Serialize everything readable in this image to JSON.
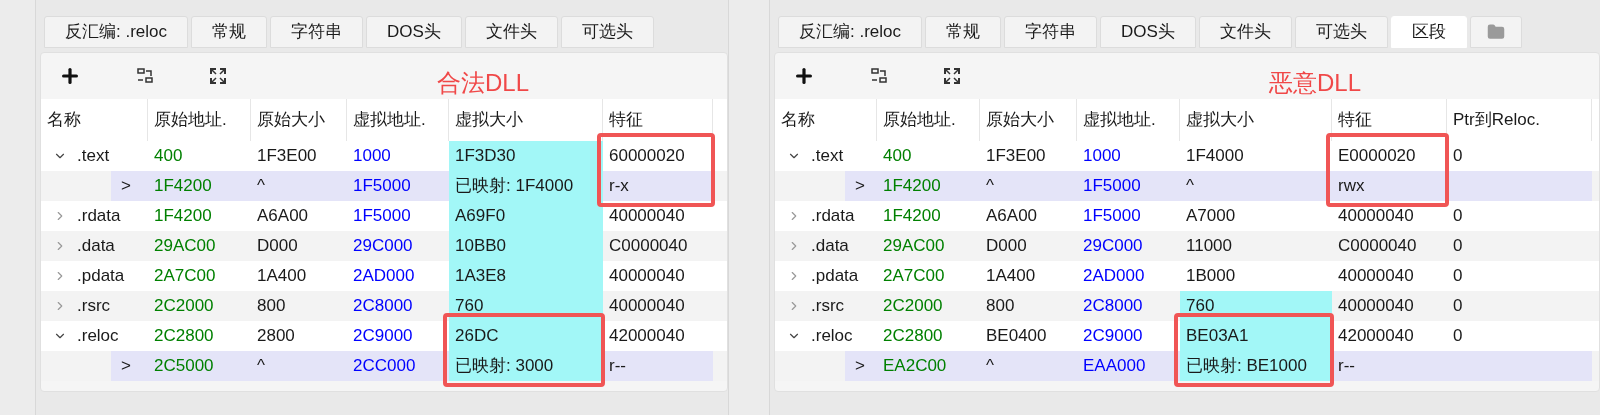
{
  "panels": [
    {
      "tabs": [
        {
          "label": "反汇编: .reloc",
          "selected": false,
          "kind": "text"
        },
        {
          "label": "常规",
          "selected": false,
          "kind": "text"
        },
        {
          "label": "字符串",
          "selected": false,
          "kind": "text"
        },
        {
          "label": "DOS头",
          "selected": false,
          "kind": "text"
        },
        {
          "label": "文件头",
          "selected": false,
          "kind": "text"
        },
        {
          "label": "可选头",
          "selected": false,
          "kind": "text"
        }
      ],
      "annotation": "合法DLL",
      "columns": [
        {
          "label": "名称",
          "kind": "name"
        },
        {
          "label": "原始地址.",
          "kind": "raw_addr"
        },
        {
          "label": "原始大小",
          "kind": "plain"
        },
        {
          "label": "虚拟地址.",
          "kind": "virt_addr"
        },
        {
          "label": "虚拟大小",
          "kind": "plain"
        },
        {
          "label": "特征",
          "kind": "plain"
        }
      ],
      "rows": [
        {
          "expanded": true,
          "cells": [
            {
              "text": ".text"
            },
            {
              "text": "400"
            },
            {
              "text": "1F3E00"
            },
            {
              "text": "1000"
            },
            {
              "text": "1F3D30",
              "highlighted": true
            },
            {
              "text": "60000020",
              "boxed": true
            }
          ],
          "children": [
            {
              "cells": [
                {
                  "text": ">"
                },
                {
                  "text": "1F4200"
                },
                {
                  "text": "^"
                },
                {
                  "text": "1F5000"
                },
                {
                  "text": "已映射: 1F4000",
                  "highlighted": true
                },
                {
                  "text": "r-x",
                  "boxed": true
                }
              ]
            }
          ]
        },
        {
          "expanded": false,
          "cells": [
            {
              "text": ".rdata"
            },
            {
              "text": "1F4200"
            },
            {
              "text": "A6A00"
            },
            {
              "text": "1F5000"
            },
            {
              "text": "A69F0",
              "highlighted": true
            },
            {
              "text": "40000040"
            }
          ]
        },
        {
          "expanded": false,
          "cells": [
            {
              "text": ".data"
            },
            {
              "text": "29AC00"
            },
            {
              "text": "D000"
            },
            {
              "text": "29C000"
            },
            {
              "text": "10BB0",
              "highlighted": true
            },
            {
              "text": "C0000040"
            }
          ]
        },
        {
          "expanded": false,
          "cells": [
            {
              "text": ".pdata"
            },
            {
              "text": "2A7C00"
            },
            {
              "text": "1A400"
            },
            {
              "text": "2AD000"
            },
            {
              "text": "1A3E8",
              "highlighted": true
            },
            {
              "text": "40000040"
            }
          ]
        },
        {
          "expanded": false,
          "cells": [
            {
              "text": ".rsrc"
            },
            {
              "text": "2C2000"
            },
            {
              "text": "800"
            },
            {
              "text": "2C8000"
            },
            {
              "text": "760",
              "highlighted": true
            },
            {
              "text": "40000040"
            }
          ]
        },
        {
          "expanded": true,
          "cells": [
            {
              "text": ".reloc"
            },
            {
              "text": "2C2800"
            },
            {
              "text": "2800"
            },
            {
              "text": "2C9000"
            },
            {
              "text": "26DC",
              "highlighted": true,
              "boxed": true
            },
            {
              "text": "42000040"
            }
          ],
          "children": [
            {
              "cells": [
                {
                  "text": ">"
                },
                {
                  "text": "2C5000"
                },
                {
                  "text": "^"
                },
                {
                  "text": "2CC000"
                },
                {
                  "text": "已映射: 3000",
                  "highlighted": true,
                  "boxed": true
                },
                {
                  "text": "r--"
                }
              ]
            }
          ]
        }
      ]
    },
    {
      "tabs": [
        {
          "label": "反汇编: .reloc",
          "selected": false,
          "kind": "text"
        },
        {
          "label": "常规",
          "selected": false,
          "kind": "text"
        },
        {
          "label": "字符串",
          "selected": false,
          "kind": "text"
        },
        {
          "label": "DOS头",
          "selected": false,
          "kind": "text"
        },
        {
          "label": "文件头",
          "selected": false,
          "kind": "text"
        },
        {
          "label": "可选头",
          "selected": false,
          "kind": "text"
        },
        {
          "label": "区段",
          "selected": true,
          "kind": "text"
        },
        {
          "selected": false,
          "kind": "folder"
        }
      ],
      "annotation": "恶意DLL",
      "columns": [
        {
          "label": "名称",
          "kind": "name"
        },
        {
          "label": "原始地址.",
          "kind": "raw_addr"
        },
        {
          "label": "原始大小",
          "kind": "plain"
        },
        {
          "label": "虚拟地址.",
          "kind": "virt_addr"
        },
        {
          "label": "虚拟大小",
          "kind": "plain"
        },
        {
          "label": "特征",
          "kind": "plain"
        },
        {
          "label": "Ptr到Reloc.",
          "kind": "plain"
        }
      ],
      "rows": [
        {
          "expanded": true,
          "cells": [
            {
              "text": ".text"
            },
            {
              "text": "400"
            },
            {
              "text": "1F3E00"
            },
            {
              "text": "1000"
            },
            {
              "text": "1F4000"
            },
            {
              "text": "E0000020",
              "boxed": true
            },
            {
              "text": "0"
            }
          ],
          "children": [
            {
              "cells": [
                {
                  "text": ">"
                },
                {
                  "text": "1F4200"
                },
                {
                  "text": "^"
                },
                {
                  "text": "1F5000"
                },
                {
                  "text": "^"
                },
                {
                  "text": "rwx",
                  "boxed": true
                }
              ]
            }
          ]
        },
        {
          "expanded": false,
          "cells": [
            {
              "text": ".rdata"
            },
            {
              "text": "1F4200"
            },
            {
              "text": "A6A00"
            },
            {
              "text": "1F5000"
            },
            {
              "text": "A7000"
            },
            {
              "text": "40000040"
            },
            {
              "text": "0"
            }
          ]
        },
        {
          "expanded": false,
          "cells": [
            {
              "text": ".data"
            },
            {
              "text": "29AC00"
            },
            {
              "text": "D000"
            },
            {
              "text": "29C000"
            },
            {
              "text": "11000"
            },
            {
              "text": "C0000040"
            },
            {
              "text": "0"
            }
          ]
        },
        {
          "expanded": false,
          "cells": [
            {
              "text": ".pdata"
            },
            {
              "text": "2A7C00"
            },
            {
              "text": "1A400"
            },
            {
              "text": "2AD000"
            },
            {
              "text": "1B000"
            },
            {
              "text": "40000040"
            },
            {
              "text": "0"
            }
          ]
        },
        {
          "expanded": false,
          "cells": [
            {
              "text": ".rsrc"
            },
            {
              "text": "2C2000"
            },
            {
              "text": "800"
            },
            {
              "text": "2C8000"
            },
            {
              "text": "760",
              "highlighted": true
            },
            {
              "text": "40000040"
            },
            {
              "text": "0"
            }
          ]
        },
        {
          "expanded": true,
          "cells": [
            {
              "text": ".reloc"
            },
            {
              "text": "2C2800"
            },
            {
              "text": "BE0400"
            },
            {
              "text": "2C9000"
            },
            {
              "text": "BE03A1",
              "highlighted": true,
              "boxed": true
            },
            {
              "text": "42000040"
            },
            {
              "text": "0"
            }
          ],
          "children": [
            {
              "cells": [
                {
                  "text": ">"
                },
                {
                  "text": "EA2C00"
                },
                {
                  "text": "^"
                },
                {
                  "text": "EAA000"
                },
                {
                  "text": "已映射: BE1000",
                  "highlighted": true,
                  "boxed": true
                },
                {
                  "text": "r--"
                }
              ]
            }
          ]
        }
      ]
    }
  ]
}
